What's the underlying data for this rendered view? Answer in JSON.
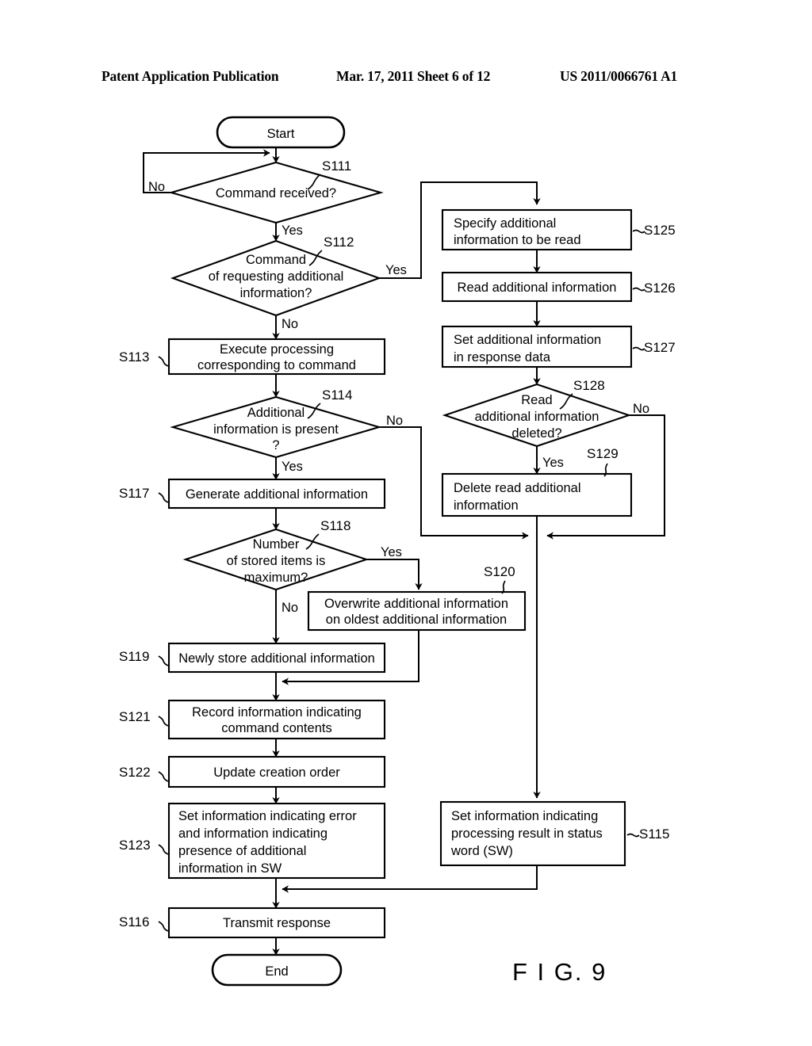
{
  "header": {
    "publication": "Patent Application Publication",
    "date_sheet": "Mar. 17, 2011  Sheet 6 of 12",
    "patent_number": "US 2011/0066761 A1"
  },
  "figure": {
    "label": "F I G. 9"
  },
  "chart_data": {
    "type": "diagram",
    "diagram_type": "flowchart",
    "title": "F I G. 9",
    "nodes": [
      {
        "id": "start",
        "step": "",
        "shape": "terminator",
        "text": "Start"
      },
      {
        "id": "s111",
        "step": "S111",
        "shape": "decision",
        "text": "Command received?"
      },
      {
        "id": "s112",
        "step": "S112",
        "shape": "decision",
        "text": "Command\nof requesting additional\ninformation?"
      },
      {
        "id": "s113",
        "step": "S113",
        "shape": "process",
        "text": "Execute processing\ncorresponding to command"
      },
      {
        "id": "s114",
        "step": "S114",
        "shape": "decision",
        "text": "Additional\ninformation is present\n?"
      },
      {
        "id": "s117",
        "step": "S117",
        "shape": "process",
        "text": "Generate additional information"
      },
      {
        "id": "s118",
        "step": "S118",
        "shape": "decision",
        "text": "Number\nof stored items is\nmaximum?"
      },
      {
        "id": "s120",
        "step": "S120",
        "shape": "process",
        "text": "Overwrite additional information\non oldest additional information"
      },
      {
        "id": "s119",
        "step": "S119",
        "shape": "process",
        "text": "Newly store additional information"
      },
      {
        "id": "s121",
        "step": "S121",
        "shape": "process",
        "text": "Record information indicating\ncommand contents"
      },
      {
        "id": "s122",
        "step": "S122",
        "shape": "process",
        "text": "Update creation order"
      },
      {
        "id": "s123",
        "step": "S123",
        "shape": "process",
        "text": "Set information indicating error\nand information indicating\npresence of additional\ninformation in SW"
      },
      {
        "id": "s116",
        "step": "S116",
        "shape": "process",
        "text": "Transmit response"
      },
      {
        "id": "end",
        "step": "",
        "shape": "terminator",
        "text": "End"
      },
      {
        "id": "s125",
        "step": "S125",
        "shape": "process",
        "text": "Specify additional\ninformation to be read"
      },
      {
        "id": "s126",
        "step": "S126",
        "shape": "process",
        "text": "Read additional information"
      },
      {
        "id": "s127",
        "step": "S127",
        "shape": "process",
        "text": "Set additional information\nin response data"
      },
      {
        "id": "s128",
        "step": "S128",
        "shape": "decision",
        "text": "Read\nadditional information\ndeleted?"
      },
      {
        "id": "s129",
        "step": "S129",
        "shape": "process",
        "text": "Delete read additional\ninformation"
      },
      {
        "id": "s115",
        "step": "S115",
        "shape": "process",
        "text": "Set information indicating\nprocessing result in status\nword (SW)"
      }
    ],
    "edges": [
      {
        "from": "start",
        "to": "s111",
        "label": ""
      },
      {
        "from": "s111",
        "to": "s111",
        "label": "No"
      },
      {
        "from": "s111",
        "to": "s112",
        "label": "Yes"
      },
      {
        "from": "s112",
        "to": "s125",
        "label": "Yes"
      },
      {
        "from": "s112",
        "to": "s113",
        "label": "No"
      },
      {
        "from": "s113",
        "to": "s114",
        "label": ""
      },
      {
        "from": "s114",
        "to": "s115",
        "label": "No"
      },
      {
        "from": "s114",
        "to": "s117",
        "label": "Yes"
      },
      {
        "from": "s117",
        "to": "s118",
        "label": ""
      },
      {
        "from": "s118",
        "to": "s120",
        "label": "Yes"
      },
      {
        "from": "s118",
        "to": "s119",
        "label": "No"
      },
      {
        "from": "s120",
        "to": "s121",
        "label": ""
      },
      {
        "from": "s119",
        "to": "s121",
        "label": ""
      },
      {
        "from": "s121",
        "to": "s122",
        "label": ""
      },
      {
        "from": "s122",
        "to": "s123",
        "label": ""
      },
      {
        "from": "s123",
        "to": "s116",
        "label": ""
      },
      {
        "from": "s116",
        "to": "end",
        "label": ""
      },
      {
        "from": "s125",
        "to": "s126",
        "label": ""
      },
      {
        "from": "s126",
        "to": "s127",
        "label": ""
      },
      {
        "from": "s127",
        "to": "s128",
        "label": ""
      },
      {
        "from": "s128",
        "to": "s129",
        "label": "Yes"
      },
      {
        "from": "s128",
        "to": "s115",
        "label": "No"
      },
      {
        "from": "s129",
        "to": "s115",
        "label": ""
      },
      {
        "from": "s115",
        "to": "s116",
        "label": ""
      }
    ]
  },
  "labels": {
    "start": "Start",
    "end": "End",
    "s111_text": "Command received?",
    "s112_l1": "Command",
    "s112_l2": "of requesting additional",
    "s112_l3": "information?",
    "s113_l1": "Execute processing",
    "s113_l2": "corresponding to command",
    "s114_l1": "Additional",
    "s114_l2": "information is present",
    "s114_l3": "?",
    "s117_l1": "Generate additional information",
    "s118_l1": "Number",
    "s118_l2": "of stored items is",
    "s118_l3": "maximum?",
    "s120_l1": "Overwrite additional information",
    "s120_l2": "on oldest additional information",
    "s119_l1": "Newly store additional information",
    "s121_l1": "Record information indicating",
    "s121_l2": "command contents",
    "s122_l1": "Update creation order",
    "s123_l1": "Set information indicating error",
    "s123_l2": "and information indicating",
    "s123_l3": "presence of additional",
    "s123_l4": "information in SW",
    "s116_l1": "Transmit response",
    "s125_l1": "Specify additional",
    "s125_l2": "information to be read",
    "s126_l1": "Read additional information",
    "s127_l1": "Set additional information",
    "s127_l2": "in response data",
    "s128_l1": "Read",
    "s128_l2": "additional information",
    "s128_l3": "deleted?",
    "s129_l1": "Delete read additional",
    "s129_l2": "information",
    "s115_l1": "Set information indicating",
    "s115_l2": "processing result in status",
    "s115_l3": "word (SW)"
  },
  "steps": {
    "s111": "S111",
    "s112": "S112",
    "s113": "S113",
    "s114": "S114",
    "s115": "S115",
    "s116": "S116",
    "s117": "S117",
    "s118": "S118",
    "s119": "S119",
    "s120": "S120",
    "s121": "S121",
    "s122": "S122",
    "s123": "S123",
    "s125": "S125",
    "s126": "S126",
    "s127": "S127",
    "s128": "S128",
    "s129": "S129"
  },
  "branches": {
    "s111_no": "No",
    "s111_yes": "Yes",
    "s112_yes": "Yes",
    "s112_no": "No",
    "s114_no": "No",
    "s114_yes": "Yes",
    "s118_yes": "Yes",
    "s118_no": "No",
    "s128_no": "No",
    "s128_yes": "Yes"
  }
}
